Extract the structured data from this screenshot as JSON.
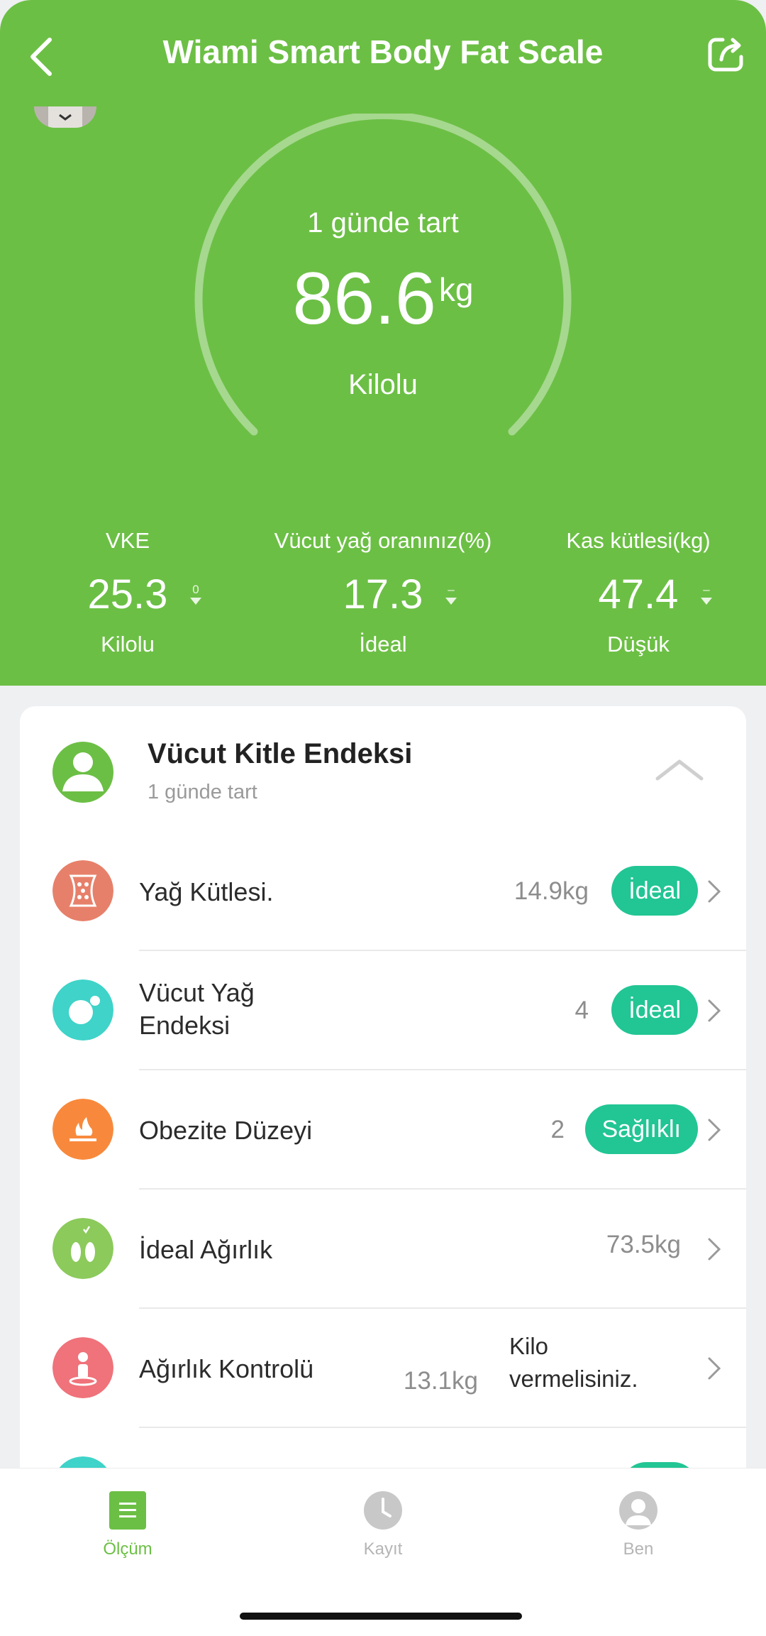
{
  "header": {
    "title": "Wiami Smart Body Fat Scale"
  },
  "gauge": {
    "subtitle": "1 günde tart",
    "value": "86.6",
    "unit": "kg",
    "status": "Kilolu"
  },
  "metrics": [
    {
      "label": "VKE",
      "value": "25.3",
      "trend": "0",
      "status": "Kilolu"
    },
    {
      "label": "Vücut yağ oranınız(%)",
      "value": "17.3",
      "trend": "–",
      "status": "İdeal"
    },
    {
      "label": "Kas kütlesi(kg)",
      "value": "47.4",
      "trend": "–",
      "status": "Düşük"
    }
  ],
  "card": {
    "title": "Vücut Kitle Endeksi",
    "subtitle": "1 günde tart",
    "rows": [
      {
        "label": "Yağ Kütlesi.",
        "value": "14.9kg",
        "badge": "İdeal",
        "icon": "fat-mass-icon"
      },
      {
        "label_line1": "Vücut Yağ",
        "label_line2": "Endeksi",
        "value": "4",
        "badge": "İdeal",
        "icon": "body-fat-index-icon"
      },
      {
        "label": "Obezite Düzeyi",
        "value": "2",
        "badge": "Sağlıklı",
        "icon": "obesity-level-icon"
      },
      {
        "label": "İdeal Ağırlık",
        "value": "73.5kg",
        "icon": "ideal-weight-icon"
      },
      {
        "label": "Ağırlık Kontrolü",
        "value": "13.1kg",
        "note_line1": "Kilo",
        "note_line2": "vermelisiniz.",
        "icon": "weight-control-icon"
      }
    ]
  },
  "tabs": [
    {
      "label": "Ölçüm",
      "icon": "measurement-icon",
      "active": true
    },
    {
      "label": "Kayıt",
      "icon": "clock-icon",
      "active": false
    },
    {
      "label": "Ben",
      "icon": "profile-icon",
      "active": false
    }
  ],
  "colors": {
    "brand_green": "#6cbf45",
    "badge_teal": "#22c594"
  }
}
